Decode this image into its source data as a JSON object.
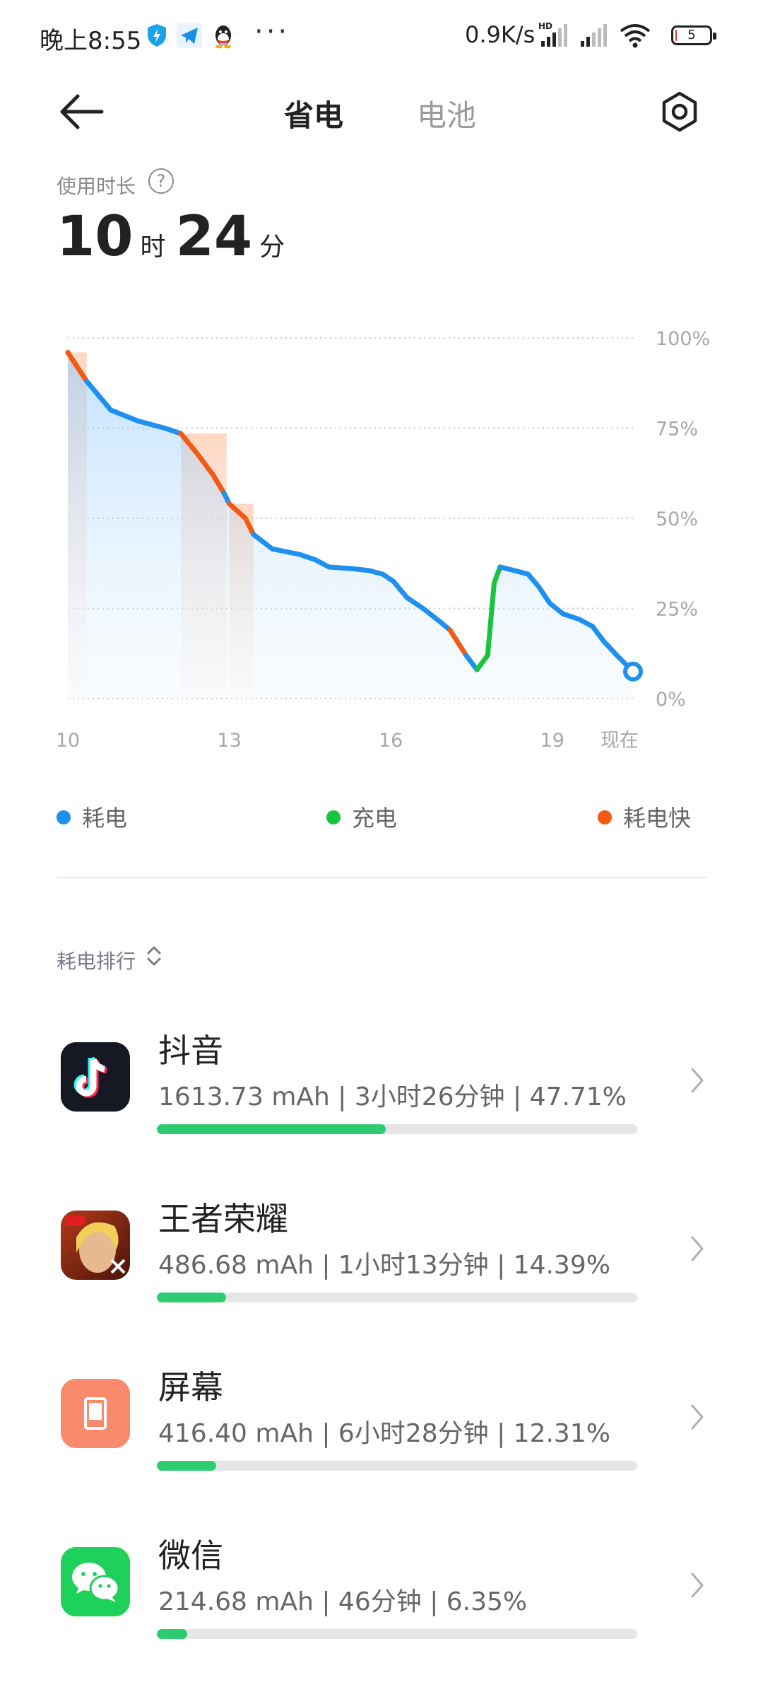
{
  "status_bar": {
    "time": "晚上8:55",
    "dots": "···",
    "network_speed": "0.9K/s",
    "signal_badge": "HD",
    "battery_level": "5",
    "battery_level_percent": 5
  },
  "header": {
    "tabs": [
      "省电",
      "电池"
    ],
    "active_tab": "省电"
  },
  "usage": {
    "label": "使用时长",
    "hours": "10",
    "hours_unit": "时",
    "minutes": "24",
    "minutes_unit": "分"
  },
  "colors": {
    "drain": "#1e90f0",
    "charge": "#17c53c",
    "fast_drain": "#f05a14"
  },
  "chart_data": {
    "type": "line",
    "x_tick_labels": [
      "10",
      "13",
      "16",
      "19",
      "现在"
    ],
    "y_tick_labels": [
      "100%",
      "75%",
      "50%",
      "25%",
      "0%"
    ],
    "ylim": [
      0,
      100
    ],
    "grid": true,
    "x_unit": "hour of day",
    "series": [
      {
        "state": "fast_drain",
        "points": [
          [
            10.0,
            96
          ],
          [
            10.35,
            88
          ]
        ]
      },
      {
        "state": "drain",
        "points": [
          [
            10.35,
            88
          ],
          [
            10.8,
            80
          ],
          [
            11.3,
            77
          ],
          [
            11.8,
            75
          ],
          [
            12.1,
            73.5
          ]
        ]
      },
      {
        "state": "fast_drain",
        "points": [
          [
            12.1,
            73.5
          ],
          [
            12.4,
            68
          ],
          [
            12.7,
            62
          ],
          [
            12.9,
            57
          ]
        ]
      },
      {
        "state": "drain",
        "points": [
          [
            12.9,
            57
          ],
          [
            13.0,
            54
          ]
        ]
      },
      {
        "state": "fast_drain",
        "points": [
          [
            13.0,
            54
          ],
          [
            13.3,
            50
          ],
          [
            13.45,
            45.5
          ]
        ]
      },
      {
        "state": "drain",
        "points": [
          [
            13.45,
            45.5
          ],
          [
            13.8,
            41.5
          ],
          [
            14.3,
            40
          ],
          [
            14.6,
            38.5
          ],
          [
            14.85,
            36.5
          ],
          [
            15.3,
            36
          ],
          [
            15.6,
            35.5
          ],
          [
            15.85,
            34.5
          ],
          [
            16.05,
            32.5
          ],
          [
            16.3,
            28
          ],
          [
            16.6,
            25
          ],
          [
            16.9,
            21.5
          ],
          [
            17.1,
            19
          ]
        ]
      },
      {
        "state": "fast_drain",
        "points": [
          [
            17.1,
            19
          ],
          [
            17.4,
            12
          ]
        ]
      },
      {
        "state": "drain",
        "points": [
          [
            17.4,
            12
          ],
          [
            17.6,
            8
          ]
        ]
      },
      {
        "state": "charge",
        "points": [
          [
            17.6,
            8
          ],
          [
            17.8,
            12
          ],
          [
            17.92,
            32
          ],
          [
            18.03,
            36.5
          ]
        ]
      },
      {
        "state": "drain",
        "points": [
          [
            18.03,
            36.5
          ],
          [
            18.3,
            35.5
          ],
          [
            18.55,
            34.5
          ],
          [
            18.75,
            31
          ],
          [
            18.95,
            26.5
          ],
          [
            19.2,
            23.5
          ],
          [
            19.5,
            22
          ],
          [
            19.75,
            20
          ],
          [
            19.95,
            16
          ],
          [
            20.2,
            12
          ],
          [
            20.5,
            7.5
          ]
        ]
      }
    ],
    "current_point": [
      20.5,
      7.5
    ],
    "shaded_fast_drain_bands": [
      [
        10.0,
        10.35
      ],
      [
        12.1,
        12.95
      ],
      [
        13.0,
        13.45
      ]
    ]
  },
  "legend": [
    {
      "label": "耗电",
      "color": "#1e90f0"
    },
    {
      "label": "充电",
      "color": "#17c53c"
    },
    {
      "label": "耗电快",
      "color": "#f05a14"
    }
  ],
  "ranking": {
    "label": "耗电排行",
    "apps": [
      {
        "name": "抖音",
        "detail": "1613.73 mAh | 3小时26分钟 | 47.71%",
        "percent": 47.71,
        "icon": "douyin-icon"
      },
      {
        "name": "王者荣耀",
        "detail": "486.68 mAh | 1小时13分钟 | 14.39%",
        "percent": 14.39,
        "icon": "honor-of-kings-icon"
      },
      {
        "name": "屏幕",
        "detail": "416.40 mAh | 6小时28分钟 | 12.31%",
        "percent": 12.31,
        "icon": "screen-icon"
      },
      {
        "name": "微信",
        "detail": "214.68 mAh | 46分钟 | 6.35%",
        "percent": 6.35,
        "icon": "wechat-icon"
      }
    ]
  }
}
